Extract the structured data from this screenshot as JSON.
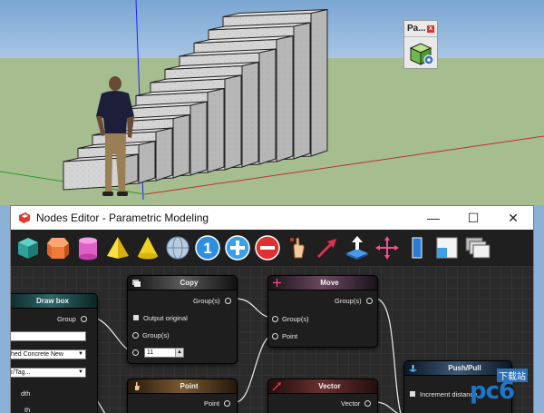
{
  "mini_toolbar": {
    "title": "Pa...",
    "close_glyph": "x",
    "button_icon": "gear-cube-icon"
  },
  "window": {
    "title": "Nodes Editor - Parametric Modeling",
    "app_icon": "sketchup-icon",
    "minimize": "—",
    "maximize": "☐",
    "close": "✕"
  },
  "toolbar": [
    {
      "name": "box",
      "icon": "cube-icon",
      "color": "#2ea39c"
    },
    {
      "name": "prism",
      "icon": "prism-icon",
      "color": "#f07a3a"
    },
    {
      "name": "cylinder",
      "icon": "cylinder-icon",
      "color": "#e060c8"
    },
    {
      "name": "pyramid",
      "icon": "pyramid-icon",
      "color": "#f0d020"
    },
    {
      "name": "cone",
      "icon": "cone-icon",
      "color": "#f0d020"
    },
    {
      "name": "sphere",
      "icon": "sphere-icon",
      "color": "#9ab4d0"
    },
    {
      "name": "number",
      "icon": "number-icon",
      "color": "#2e8fe0",
      "label": "1"
    },
    {
      "name": "add",
      "icon": "plus-icon",
      "color": "#3aa0e8",
      "label": "+"
    },
    {
      "name": "subtract",
      "icon": "minus-icon",
      "color": "#e03030",
      "label": "−"
    },
    {
      "name": "point",
      "icon": "hand-point-icon",
      "color": "#f0c080"
    },
    {
      "name": "vector",
      "icon": "vector-arrow-icon",
      "color": "#e03050"
    },
    {
      "name": "push-pull",
      "icon": "push-pull-icon",
      "color": "#3a90e0"
    },
    {
      "name": "move",
      "icon": "move-icon",
      "color": "#f05090"
    },
    {
      "name": "rectangle",
      "icon": "rectangle-icon",
      "color": "#2a7ad0"
    },
    {
      "name": "scale",
      "icon": "scale-icon",
      "color": "#3aa0e8"
    },
    {
      "name": "copy",
      "icon": "copy-icon",
      "color": "#dddddd"
    }
  ],
  "nodes": {
    "draw_box": {
      "title": "Draw box",
      "output": "Group",
      "material": "hed Concrete New",
      "layer": "r/Tag...",
      "width_label": "dth",
      "depth_label": "th"
    },
    "copy": {
      "title": "Copy",
      "output": "Group(s)",
      "output_original": "Output original",
      "group_input": "Group(s)",
      "count": "11"
    },
    "move": {
      "title": "Move",
      "output": "Group(s)",
      "group_input": "Group(s)",
      "point_input": "Point"
    },
    "point": {
      "title": "Point",
      "output": "Point"
    },
    "vector": {
      "title": "Vector",
      "output": "Vector"
    },
    "push_pull": {
      "title": "Push/Pull",
      "increment": "Increment distance"
    }
  },
  "watermark": {
    "text": "下载站",
    "logo": "pc6"
  }
}
